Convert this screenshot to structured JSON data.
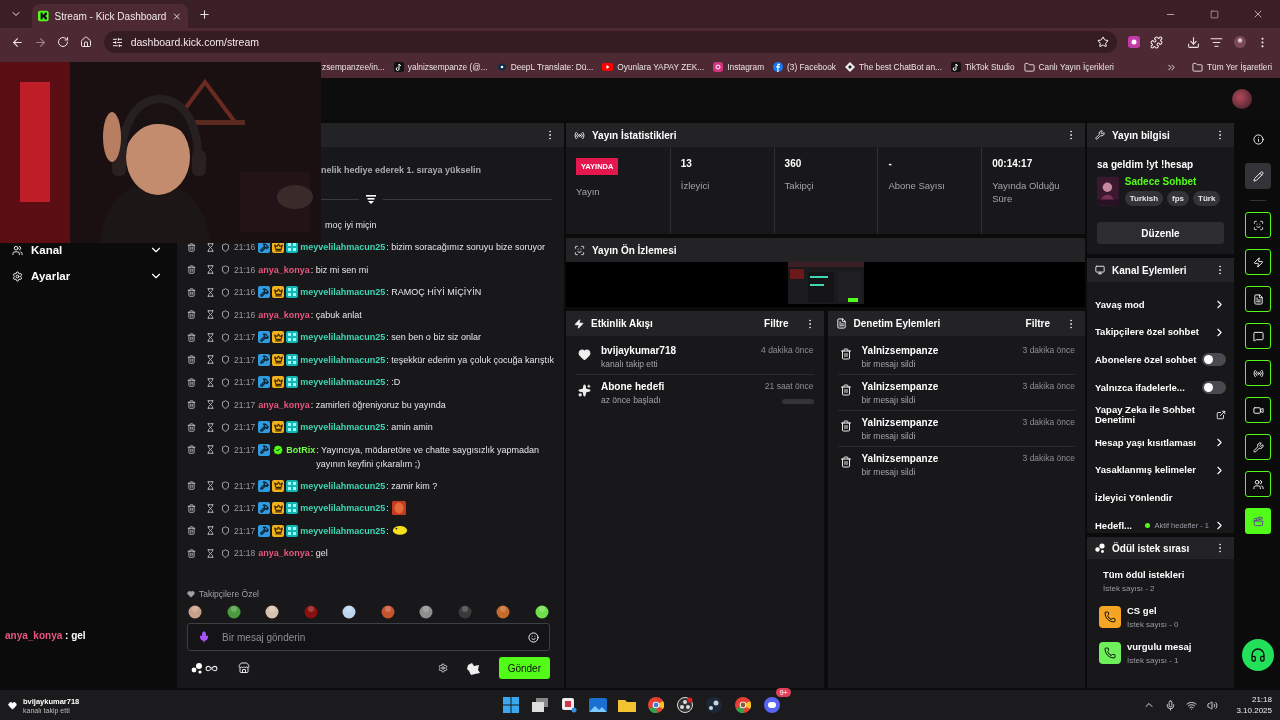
{
  "browser": {
    "tab_title": "Stream - Kick Dashboard",
    "url": "dashboard.kick.com/stream",
    "bookmarks": [
      {
        "label": "zsempanzee/in...",
        "kind": "none"
      },
      {
        "label": "yalnizsempanze (@...",
        "kind": "tiktok"
      },
      {
        "label": "DeepL Translate: Dü...",
        "kind": "deepl"
      },
      {
        "label": "Oyunlara YAPAY ZEK...",
        "kind": "youtube"
      },
      {
        "label": "Instagram",
        "kind": "instagram"
      },
      {
        "label": "(3) Facebook",
        "kind": "facebook"
      },
      {
        "label": "The best ChatBot an...",
        "kind": "web"
      },
      {
        "label": "TikTok Studio",
        "kind": "tiktok"
      },
      {
        "label": "Canlı Yayın İçerikleri",
        "kind": "folder"
      }
    ],
    "all_bookmarks": "Tüm Yer İşaretleri"
  },
  "sidebar": {
    "items": [
      {
        "label": "Kanal",
        "expanded": false
      },
      {
        "label": "Ayarlar",
        "expanded": false
      }
    ],
    "chat_overlay": {
      "user": "anya_konya",
      "text": " : gel",
      "color": "#e9567f"
    }
  },
  "chat": {
    "pinned": "nelik hediye ederek 1. sıraya yükselin",
    "messages": [
      {
        "kind": "partial",
        "text": "moç iyi miçin"
      },
      {
        "kind": "message",
        "time": "21:16",
        "badges": [
          {
            "kind": "mod"
          },
          {
            "kind": "crown"
          },
          {
            "kind": "og"
          }
        ],
        "user": "meyvelilahmacun25",
        "color": "#3fd6b4",
        "text": ": bizim soracağımız soruyu bize soruyor"
      },
      {
        "kind": "message",
        "time": "21:16",
        "user": "anya_konya",
        "color": "#e9567f",
        "text": ": biz mi sen mi"
      },
      {
        "kind": "message",
        "time": "21:16",
        "badges": [
          {
            "kind": "mod"
          },
          {
            "kind": "crown"
          },
          {
            "kind": "og"
          }
        ],
        "user": "meyvelilahmacun25",
        "color": "#3fd6b4",
        "text": ": RAMOÇ HİYİ MİÇİYİN"
      },
      {
        "kind": "message",
        "time": "21:16",
        "user": "anya_konya",
        "color": "#e9567f",
        "text": ": çabuk anlat"
      },
      {
        "kind": "message",
        "time": "21:17",
        "badges": [
          {
            "kind": "mod"
          },
          {
            "kind": "crown"
          },
          {
            "kind": "og"
          }
        ],
        "user": "meyvelilahmacun25",
        "color": "#3fd6b4",
        "text": ": sen ben o biz siz onlar"
      },
      {
        "kind": "message",
        "time": "21:17",
        "badges": [
          {
            "kind": "mod"
          },
          {
            "kind": "crown"
          },
          {
            "kind": "og"
          }
        ],
        "user": "meyvelilahmacun25",
        "color": "#3fd6b4",
        "text": ": teşekkür ederim ya çoluk çocuğa karıştık"
      },
      {
        "kind": "message",
        "time": "21:17",
        "badges": [
          {
            "kind": "mod"
          },
          {
            "kind": "crown"
          },
          {
            "kind": "og"
          }
        ],
        "user": "meyvelilahmacun25",
        "color": "#3fd6b4",
        "text": ": :D"
      },
      {
        "kind": "message",
        "time": "21:17",
        "user": "anya_konya",
        "color": "#e9567f",
        "text": ": zamirleri öğreniyoruz bu yayında"
      },
      {
        "kind": "message",
        "time": "21:17",
        "badges": [
          {
            "kind": "mod"
          },
          {
            "kind": "crown"
          },
          {
            "kind": "og"
          }
        ],
        "user": "meyvelilahmacun25",
        "color": "#3fd6b4",
        "text": ": amin amin"
      },
      {
        "kind": "message",
        "time": "21:17",
        "badges": [
          {
            "kind": "mod"
          },
          {
            "kind": "verified"
          }
        ],
        "user": "BotRix",
        "color": "#75fd46",
        "text": ": Yayıncıya, mödaretöre ve chatte saygısızlık yapmadan yayının keyfini çıkaralım ;)"
      },
      {
        "kind": "message",
        "time": "21:17",
        "badges": [
          {
            "kind": "mod"
          },
          {
            "kind": "crown"
          },
          {
            "kind": "og"
          }
        ],
        "user": "meyvelilahmacun25",
        "color": "#3fd6b4",
        "text": ": zamir kim ?"
      },
      {
        "kind": "message",
        "time": "21:17",
        "badges": [
          {
            "kind": "mod"
          },
          {
            "kind": "crown"
          },
          {
            "kind": "og"
          }
        ],
        "user": "meyvelilahmacun25",
        "color": "#3fd6b4",
        "text": ":",
        "emote": {
          "kind": "face"
        }
      },
      {
        "kind": "message",
        "time": "21:17",
        "badges": [
          {
            "kind": "mod"
          },
          {
            "kind": "crown"
          },
          {
            "kind": "og"
          }
        ],
        "user": "meyvelilahmacun25",
        "color": "#3fd6b4",
        "text": ":",
        "emote": {
          "kind": "bird"
        }
      },
      {
        "kind": "message",
        "time": "21:18",
        "user": "anya_konya",
        "color": "#e9567f",
        "text": ": gel"
      }
    ],
    "emote_section": "Takipçilere Özel",
    "input": {
      "placeholder": "Bir mesaj gönderin"
    },
    "send": "Gönder"
  },
  "stats": {
    "title": "Yayın İstatistikleri",
    "cells": [
      {
        "kind": "badge",
        "value": "YAYINDA",
        "label": "Yayın"
      },
      {
        "kind": "number",
        "value": "13",
        "label": "İzleyici"
      },
      {
        "kind": "number",
        "value": "360",
        "label": "Takipçi"
      },
      {
        "kind": "number",
        "value": "-",
        "label": "Abone Sayısı"
      },
      {
        "kind": "number",
        "value": "00:14:17",
        "label": "Yayında Olduğu Süre"
      }
    ]
  },
  "preview": {
    "title": "Yayın Ön İzlemesi"
  },
  "activity": {
    "title": "Etkinlik Akışı",
    "filter": "Filtre",
    "items": [
      {
        "kind": "follow",
        "title": "bvijaykumar718",
        "detail": "kanalı takip etti",
        "time": "4 dakika önce"
      },
      {
        "kind": "goal",
        "title": "Abone hedefi",
        "detail": "az önce başladı",
        "time": "21 saat önce",
        "level": 0
      }
    ]
  },
  "moderation": {
    "title": "Denetim Eylemleri",
    "filter": "Filtre",
    "items": [
      {
        "title": "Yalnizsempanze",
        "detail": "bir mesajı sildi",
        "time": "3 dakika önce"
      },
      {
        "title": "Yalnizsempanze",
        "detail": "bir mesajı sildi",
        "time": "3 dakika önce"
      },
      {
        "title": "Yalnizsempanze",
        "detail": "bir mesajı sildi",
        "time": "3 dakika önce"
      },
      {
        "title": "Yalnizsempanze",
        "detail": "bir mesajı sildi",
        "time": "3 dakika önce"
      }
    ]
  },
  "stream_info": {
    "title": "Yayın bilgisi",
    "stream_title": "sa geldim !yt !hesap",
    "category": "Sadece Sohbet",
    "tags": [
      "Turkish",
      "fps",
      "Türk"
    ],
    "edit": "Düzenle"
  },
  "channel_actions": {
    "title": "Kanal Eylemleri",
    "items": [
      {
        "kind": "arrow",
        "label": "Yavaş mod"
      },
      {
        "kind": "arrow",
        "label": "Takipçilere özel sohbet"
      },
      {
        "kind": "toggle",
        "label": "Abonelere özel sohbet",
        "on": false
      },
      {
        "kind": "toggle",
        "label": "Yalnızca ifadelerle...",
        "on": false
      },
      {
        "kind": "external",
        "label": "Yapay Zeka ile Sohbet Denetimi"
      },
      {
        "kind": "arrow",
        "label": "Hesap yaşı kısıtlaması"
      },
      {
        "kind": "arrow",
        "label": "Yasaklanmış kelimeler"
      },
      {
        "kind": "plain",
        "label": "İzleyici Yönlendir"
      },
      {
        "kind": "goal",
        "label": "Hedefl...",
        "status": "Aktif hedefler - 1"
      }
    ]
  },
  "rewards": {
    "title": "Ödül istek sırası",
    "all": {
      "title": "Tüm ödül istekleri",
      "count": "İstek sayısı - 2"
    },
    "items": [
      {
        "title": "CS gel",
        "count": "İstek sayısı - 0",
        "color": "#f5a524"
      },
      {
        "title": "vurgulu mesaj",
        "count": "İstek sayısı - 1",
        "color": "#6ef05a"
      }
    ]
  },
  "rail": [
    {
      "kind": "plain",
      "selected": false
    },
    {
      "kind": "plain",
      "selected": true
    },
    {
      "kind": "outlined",
      "selected": false
    },
    {
      "kind": "outlined",
      "selected": false
    },
    {
      "kind": "outlined",
      "selected": false
    },
    {
      "kind": "outlined",
      "selected": false
    },
    {
      "kind": "outlined",
      "selected": false
    },
    {
      "kind": "outlined",
      "selected": false
    },
    {
      "kind": "outlined",
      "selected": false
    },
    {
      "kind": "outlined",
      "selected": false
    },
    {
      "kind": "filled",
      "selected": false
    }
  ],
  "taskbar": {
    "toast": {
      "title": "bvijaykumar718",
      "detail": "kanalı takip etti"
    },
    "app_badge": "9+",
    "time": "21:18",
    "date": "3.10.2025"
  }
}
